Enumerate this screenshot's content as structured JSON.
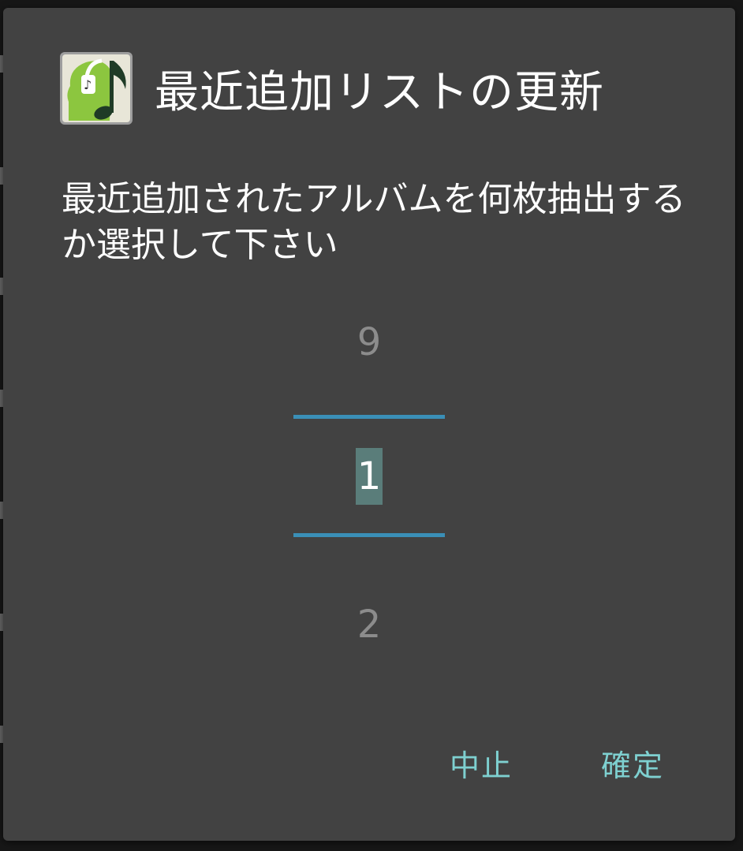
{
  "dialog": {
    "title": "最近追加リストの更新",
    "message": "最近追加されたアルバムを何枚抽出するか選択して下さい",
    "app_icon": "music-headphone-app-icon"
  },
  "picker": {
    "prev_value": "9",
    "current_value": "1",
    "next_value": "2",
    "accent_color": "#3a8fb7"
  },
  "buttons": {
    "cancel_label": "中止",
    "ok_label": "確定",
    "color": "#7ed0d0"
  },
  "colors": {
    "dialog_background": "#424242",
    "selection_highlight": "#5a7d7a"
  }
}
